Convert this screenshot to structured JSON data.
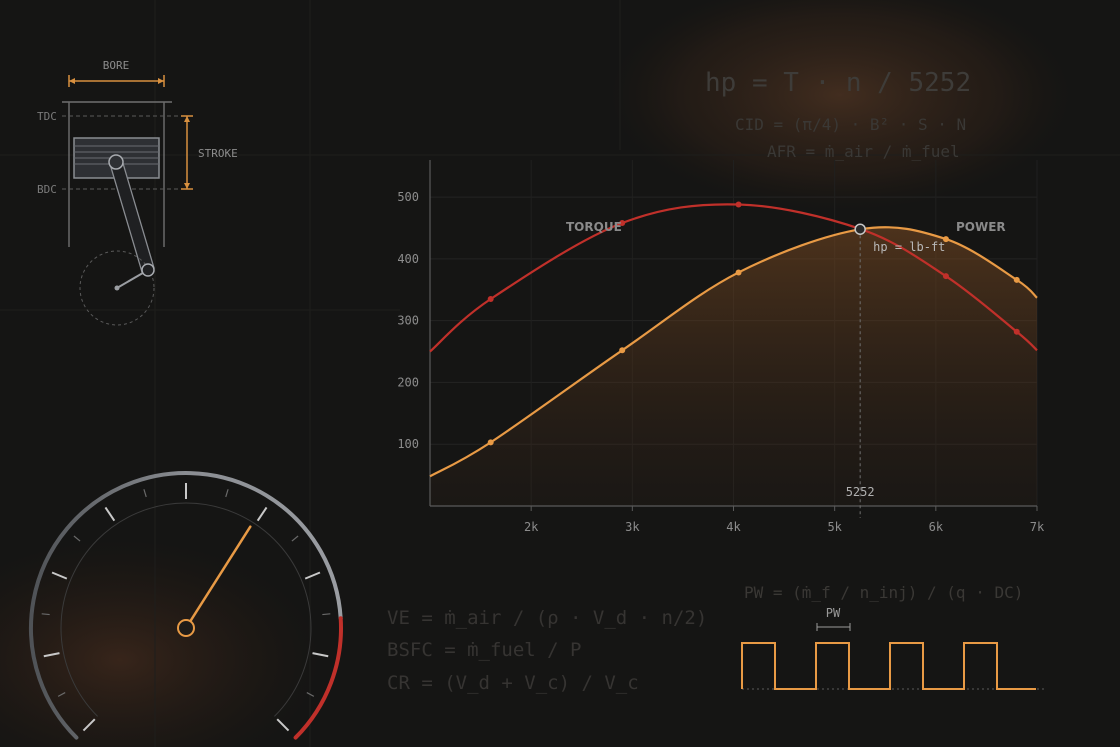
{
  "colors": {
    "background": "#151514",
    "torque": "#c0302a",
    "power": "#e89a45",
    "accent_orange": "#d8903f",
    "axis": "#5a5a5a",
    "label": "#8c8c8c",
    "formula": "#3e3c39",
    "gauge_rim": "#8a8d92",
    "needle": "#e89a45"
  },
  "formulas": {
    "hp": "hp = T · n / 5252",
    "cid": "CID = (π/4) · B² · S · N",
    "afr": "AFR = ṁ_air / ṁ_fuel",
    "ve": "VE = ṁ_air / (ρ · V_d · n/2)",
    "bsfc": "BSFC = ṁ_fuel / P",
    "cr": "CR = (V_d + V_c) / V_c",
    "pw": "PW = (ṁ_f / n_inj) / (q · DC)"
  },
  "piston_diagram": {
    "bore_label": "BORE",
    "stroke_label": "STROKE",
    "tdc_label": "TDC",
    "bdc_label": "BDC"
  },
  "gauge": {
    "needle_fraction": 0.62,
    "redline_fraction": 0.82
  },
  "pulse_diagram": {
    "label": "PW",
    "pulse_count": 4
  },
  "chart_data": {
    "type": "line",
    "title": "",
    "xlabel": "",
    "ylabel": "",
    "xlim": [
      1000,
      7000
    ],
    "ylim": [
      0,
      560
    ],
    "x_ticks": [
      {
        "value": 2000,
        "label": "2k"
      },
      {
        "value": 3000,
        "label": "3k"
      },
      {
        "value": 4000,
        "label": "4k"
      },
      {
        "value": 5000,
        "label": "5k"
      },
      {
        "value": 6000,
        "label": "6k"
      },
      {
        "value": 7000,
        "label": "7k"
      }
    ],
    "y_ticks": [
      {
        "value": 100,
        "label": "100"
      },
      {
        "value": 200,
        "label": "200"
      },
      {
        "value": 300,
        "label": "300"
      },
      {
        "value": 400,
        "label": "400"
      },
      {
        "value": 500,
        "label": "500"
      }
    ],
    "grid": true,
    "series": [
      {
        "name": "TORQUE",
        "color": "#c0302a",
        "x": [
          1000,
          1600,
          2900,
          4050,
          5260,
          6100,
          6800,
          7000
        ],
        "y": [
          250,
          335,
          458,
          488,
          448,
          372,
          282,
          252
        ],
        "markers": [
          1600,
          2900,
          4050,
          6100,
          6800
        ]
      },
      {
        "name": "POWER",
        "color": "#e89a45",
        "x": [
          1000,
          1600,
          2900,
          4050,
          5260,
          6100,
          6800,
          7000
        ],
        "y": [
          48,
          103,
          252,
          378,
          448,
          432,
          366,
          337
        ],
        "markers": [
          1600,
          2900,
          4050,
          6100,
          6800
        ]
      }
    ],
    "crossover": {
      "x": 5252,
      "y": 448,
      "x_label": "5252",
      "note": "hp = lb-ft"
    }
  }
}
